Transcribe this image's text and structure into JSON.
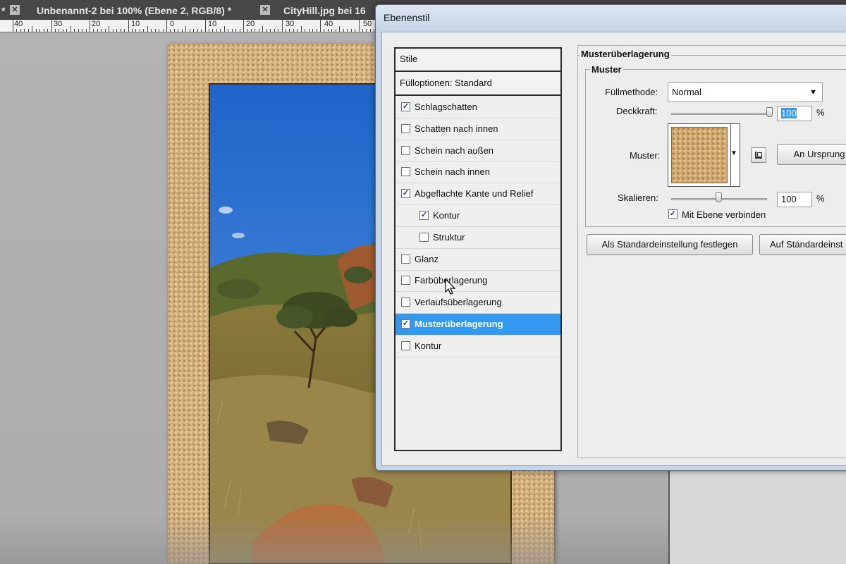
{
  "tabs": [
    {
      "label": "*"
    },
    {
      "label": "Unbenannt-2 bei 100% (Ebene 2, RGB/8) *"
    },
    {
      "label": "CityHill.jpg bei 16"
    }
  ],
  "ruler": {
    "labels": [
      "40",
      "30",
      "20",
      "10",
      "0",
      "10",
      "20",
      "30",
      "40",
      "50"
    ]
  },
  "dialog": {
    "title": "Ebenenstil",
    "list": {
      "header": "Stile",
      "blending_options": "Fülloptionen: Standard",
      "items": [
        {
          "label": "Schlagschatten",
          "checked": true,
          "indent": 0,
          "selected": false
        },
        {
          "label": "Schatten nach innen",
          "checked": false,
          "indent": 0,
          "selected": false
        },
        {
          "label": "Schein nach außen",
          "checked": false,
          "indent": 0,
          "selected": false
        },
        {
          "label": "Schein nach innen",
          "checked": false,
          "indent": 0,
          "selected": false
        },
        {
          "label": "Abgeflachte Kante und Relief",
          "checked": true,
          "indent": 0,
          "selected": false
        },
        {
          "label": "Kontur",
          "checked": true,
          "indent": 1,
          "selected": false
        },
        {
          "label": "Struktur",
          "checked": false,
          "indent": 1,
          "selected": false
        },
        {
          "label": "Glanz",
          "checked": false,
          "indent": 0,
          "selected": false
        },
        {
          "label": "Farbüberlagerung",
          "checked": false,
          "indent": 0,
          "selected": false
        },
        {
          "label": "Verlaufsüberlagerung",
          "checked": false,
          "indent": 0,
          "selected": false
        },
        {
          "label": "Musterüberlagerung",
          "checked": true,
          "indent": 0,
          "selected": true
        },
        {
          "label": "Kontur",
          "checked": false,
          "indent": 0,
          "selected": false
        }
      ]
    },
    "panel": {
      "section_title": "Musterüberlagerung",
      "group_title": "Muster",
      "blend_mode_label": "Füllmethode:",
      "blend_mode_value": "Normal",
      "opacity_label": "Deckkraft:",
      "opacity_value": "100",
      "opacity_unit": "%",
      "opacity_fraction": 1.0,
      "pattern_label": "Muster:",
      "snap_origin_button": "An Ursprung",
      "scale_label": "Skalieren:",
      "scale_value": "100",
      "scale_unit": "%",
      "scale_fraction": 0.5,
      "link_layer_label": "Mit Ebene verbinden",
      "link_layer_checked": true,
      "set_default_button": "Als Standardeinstellung festlegen",
      "reset_default_button": "Auf Standardeinst"
    }
  },
  "colors": {
    "selection": "#3399ee",
    "dialog_frame": "#c7d5e6",
    "dialog_body": "#ededed",
    "frame_texture": "#d6b27e"
  }
}
